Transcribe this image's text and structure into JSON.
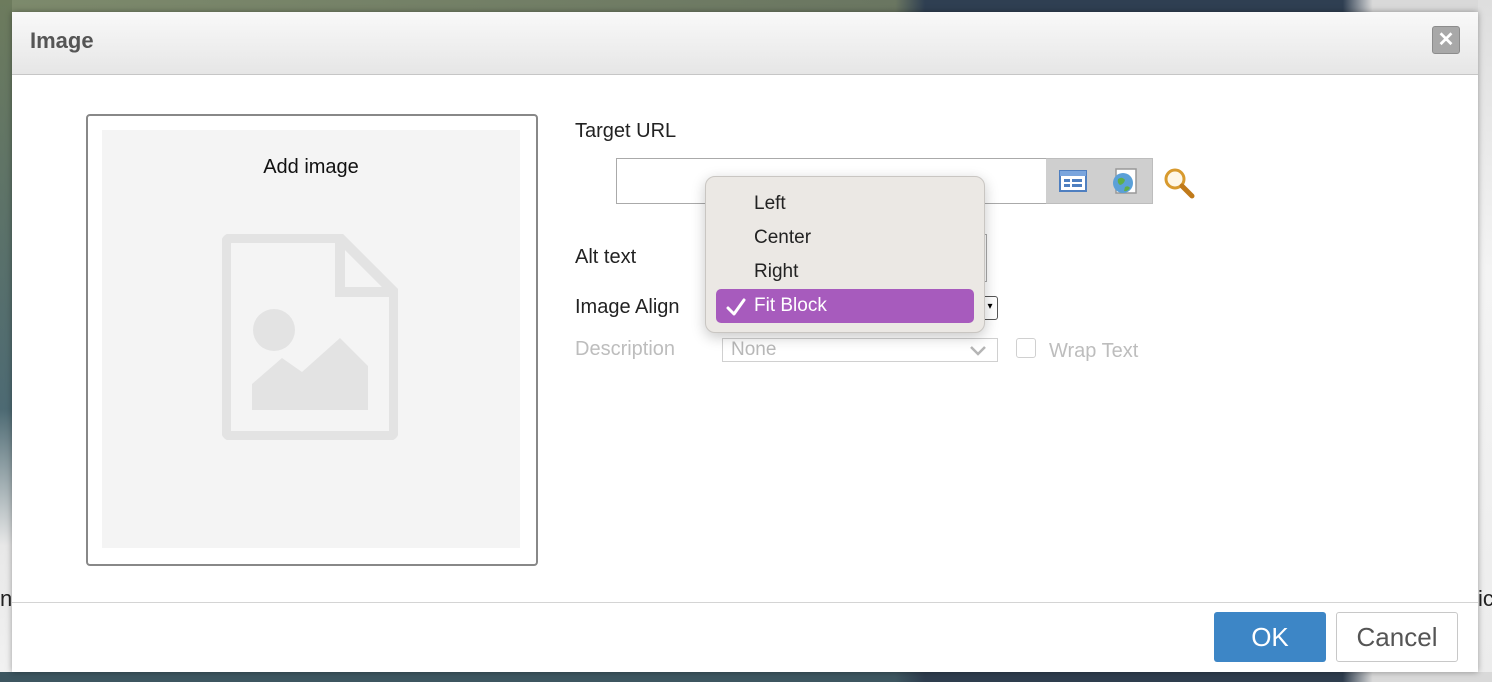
{
  "dialog": {
    "title": "Image",
    "close_label": "✕"
  },
  "image_panel": {
    "add_image_label": "Add image"
  },
  "form": {
    "target_url_label": "Target URL",
    "target_url_value": "",
    "alt_text_label": "Alt text",
    "image_align_label": "Image Align",
    "description_label": "Description",
    "description_value": "None",
    "wrap_text_label": "Wrap Text",
    "wrap_text_checked": false
  },
  "align_menu": {
    "items": [
      {
        "label": "Left",
        "selected": false
      },
      {
        "label": "Center",
        "selected": false
      },
      {
        "label": "Right",
        "selected": false
      },
      {
        "label": "Fit Block",
        "selected": true
      }
    ]
  },
  "footer": {
    "ok_label": "OK",
    "cancel_label": "Cancel"
  },
  "background": {
    "left_char": "n",
    "right_char": "ic"
  },
  "colors": {
    "accent": "#3d86c6",
    "menu_selected": "#a75bbd",
    "disabled_text": "#bdbdbd"
  },
  "icons": [
    "close-icon",
    "image-placeholder-icon",
    "browse-list-icon",
    "globe-icon",
    "search-icon",
    "chevron-down-icon",
    "checkmark-icon"
  ]
}
